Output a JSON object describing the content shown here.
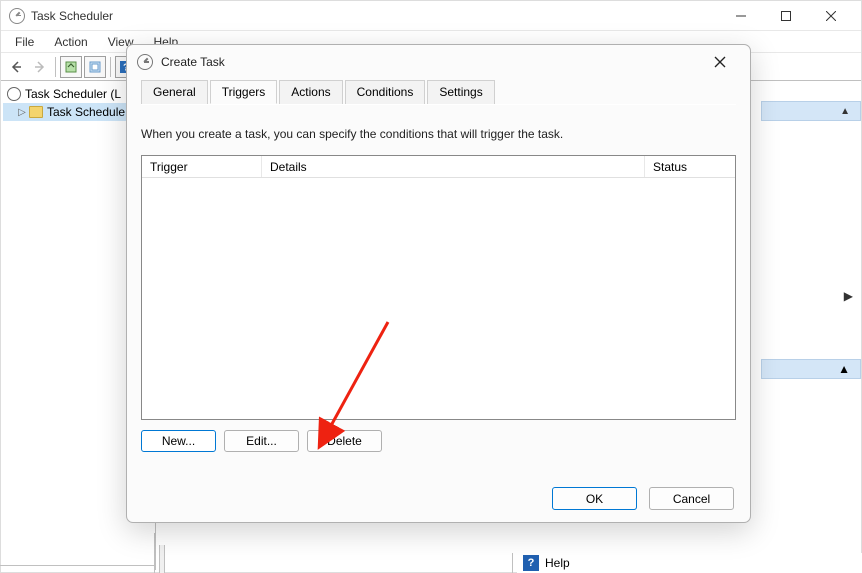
{
  "window": {
    "title": "Task Scheduler"
  },
  "menu": {
    "file": "File",
    "action": "Action",
    "view": "View",
    "help": "Help"
  },
  "tree": {
    "root": "Task Scheduler (L",
    "child": "Task Schedule"
  },
  "bottom": {
    "help": "Help"
  },
  "dialog": {
    "title": "Create Task",
    "tabs": {
      "general": "General",
      "triggers": "Triggers",
      "actions": "Actions",
      "conditions": "Conditions",
      "settings": "Settings"
    },
    "hint": "When you create a task, you can specify the conditions that will trigger the task.",
    "columns": {
      "trigger": "Trigger",
      "details": "Details",
      "status": "Status"
    },
    "buttons": {
      "new": "New...",
      "edit": "Edit...",
      "delete": "Delete",
      "ok": "OK",
      "cancel": "Cancel"
    }
  }
}
